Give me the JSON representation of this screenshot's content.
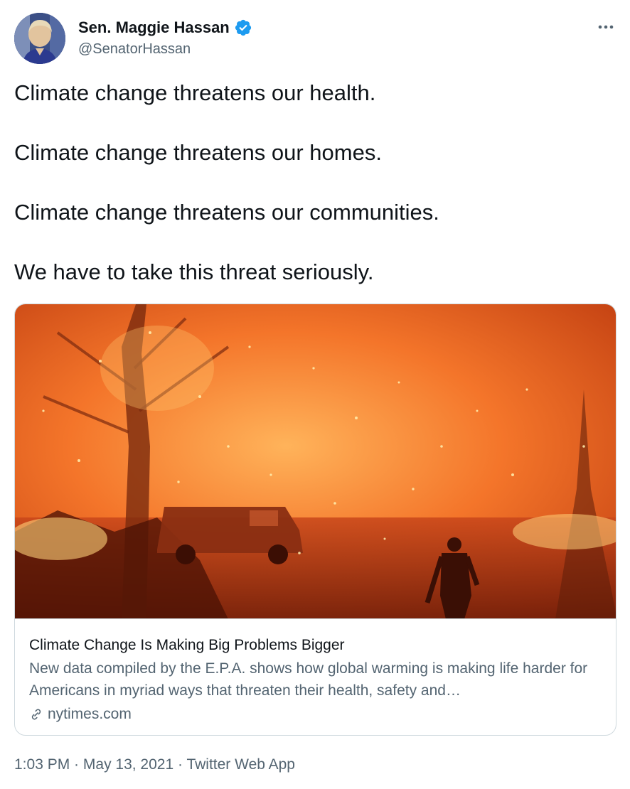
{
  "author": {
    "display_name": "Sen. Maggie Hassan",
    "handle": "@SenatorHassan",
    "verified_icon": "verified-badge-icon",
    "avatar_icon": "avatar"
  },
  "more_icon": "more-icon",
  "tweet": {
    "lines": [
      "Climate change threatens our health.",
      "Climate change threatens our homes.",
      "Climate change threatens our communities.",
      "We have to take this threat seriously."
    ]
  },
  "card": {
    "title": "Climate Change Is Making Big Problems Bigger",
    "description": "New data compiled by the E.P.A. shows how global warming is making life harder for Americans in myriad ways that threaten their health, safety and…",
    "domain": "nytimes.com",
    "link_icon": "link-icon"
  },
  "meta": {
    "time": "1:03 PM",
    "separator": " · ",
    "date": "May 13, 2021",
    "source": "Twitter Web App"
  },
  "colors": {
    "text": "#0f1419",
    "secondary": "#536471",
    "border": "#cfd9de",
    "verified": "#1d9bf0"
  }
}
